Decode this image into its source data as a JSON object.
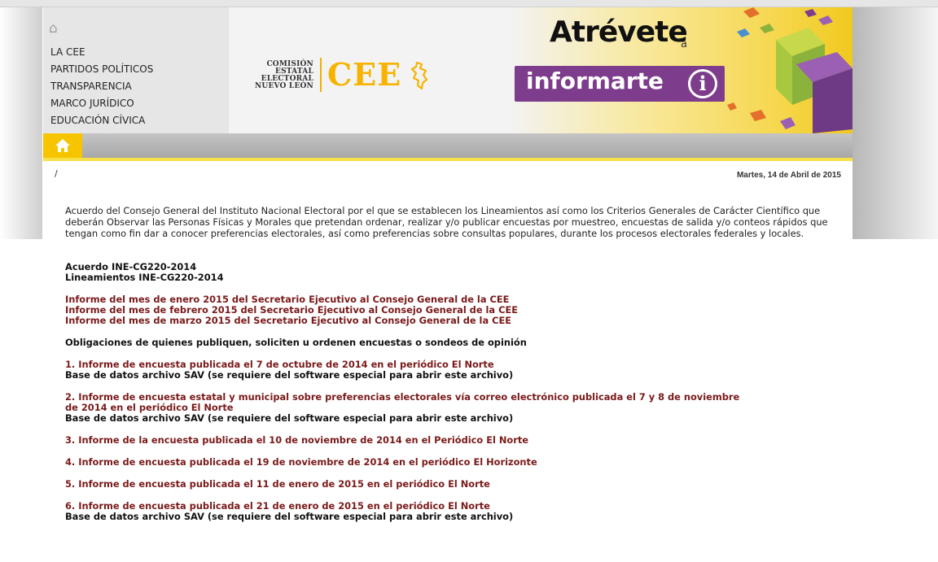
{
  "nav": {
    "home_icon": "home-outline-icon",
    "items": [
      {
        "label": "LA CEE"
      },
      {
        "label": "PARTIDOS POLÍTICOS"
      },
      {
        "label": "TRANSPARENCIA"
      },
      {
        "label": "MARCO JURÍDICO"
      },
      {
        "label": "EDUCACIÓN CÍVICA"
      }
    ]
  },
  "brand": {
    "line1": "COMISIÓN",
    "line2": "ESTATAL",
    "line3": "ELECTORAL",
    "line4": "NUEVO LEÓN",
    "logo_text": "CEE",
    "color": "#f7b300"
  },
  "promo": {
    "title": "Atrévete",
    "title_suffix": "a",
    "box_text": "informarte",
    "info_glyph": "i",
    "box_color": "#7d3c8c"
  },
  "toolbar": {
    "home_icon": "home-icon",
    "accent": "#f7c400"
  },
  "page": {
    "breadcrumb": "/",
    "date": "Martes, 14 de Abril de 2015",
    "intro": "Acuerdo del Consejo General del Instituto Nacional Electoral por el que se establecen los Lineamientos así como los Criterios Generales de Carácter Científico que deberán Observar las Personas Físicas y Morales que pretendan ordenar, realizar y/o publicar encuestas por muestreo, encuestas de salida y/o conteos rápidos que tengan como fin dar a conocer preferencias electorales, así como preferencias sobre consultas populares, durante los procesos electorales federales y locales."
  },
  "acuerdos": [
    {
      "label": "Acuerdo INE-CG220-2014"
    },
    {
      "label": "Lineamientos INE-CG220-2014"
    }
  ],
  "informes": [
    {
      "label": "Informe del mes de enero 2015 del Secretario Ejecutivo al Consejo General de la CEE"
    },
    {
      "label": "Informe del mes de febrero 2015 del Secretario Ejecutivo al Consejo General de la CEE"
    },
    {
      "label": "Informe del mes de marzo 2015 del Secretario Ejecutivo al Consejo General de la CEE"
    }
  ],
  "obligaciones": "Obligaciones de quienes publiquen, soliciten u ordenen encuestas o sondeos de opinión",
  "encuestas": {
    "e1": {
      "title": "1. Informe de encuesta publicada el 7 de octubre de 2014 en el periódico El Norte",
      "base": "Base de datos archivo SAV (se requiere del software especial para abrir este archivo)"
    },
    "e2": {
      "title_line1": "2. Informe de encuesta estatal y municipal sobre preferencias electorales vía correo electrónico publicada el 7 y 8 de noviembre",
      "title_line2": "de 2014 en el periódico El Norte",
      "base": "Base de datos archivo SAV (se requiere del software especial para abrir este archivo)"
    },
    "e3": {
      "title": "3. Informe de la encuesta publicada el 10 de noviembre de 2014 en el Periódico El Norte"
    },
    "e4": {
      "title": "4. Informe de encuesta publicada el 19 de noviembre de 2014 en el periódico El Horizonte"
    },
    "e5": {
      "title": "5. Informe de encuesta publicada el 11 de enero de 2015 en el periódico El Norte"
    },
    "e6": {
      "title": "6. Informe de encuesta publicada el 21 de enero de 2015 en el periódico El Norte",
      "base": "Base de datos archivo SAV (se requiere del software especial para abrir este archivo)"
    }
  }
}
